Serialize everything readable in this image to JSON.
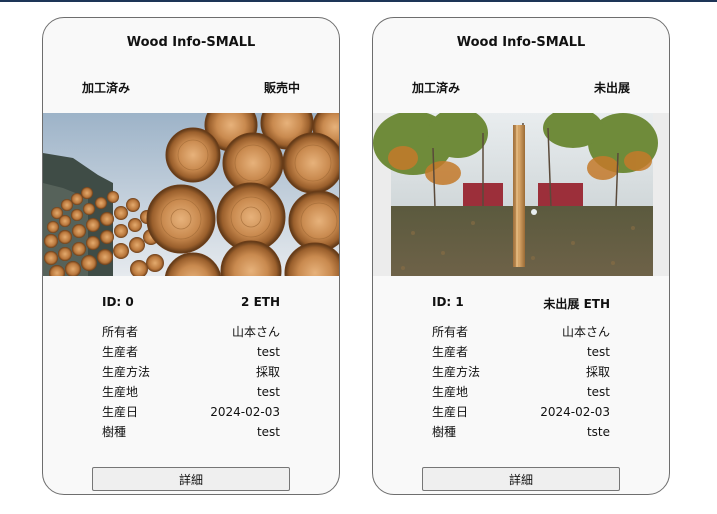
{
  "cards": [
    {
      "title": "Wood Info-SMALL",
      "processing_status": "加工済み",
      "sale_status": "販売中",
      "id_text": "ID: 0",
      "price_text": "2 ETH",
      "details": [
        {
          "label": "所有者",
          "value": "山本さん"
        },
        {
          "label": "生産者",
          "value": "test"
        },
        {
          "label": "生産方法",
          "value": "採取"
        },
        {
          "label": "生産地",
          "value": "test"
        },
        {
          "label": "生産日",
          "value": "2024-02-03"
        },
        {
          "label": "樹種",
          "value": "test"
        }
      ],
      "button_label": "詳細",
      "image": "stacked-logs-photo"
    },
    {
      "title": "Wood Info-SMALL",
      "processing_status": "加工済み",
      "sale_status": "未出展",
      "id_text": "ID: 1",
      "price_text": "未出展 ETH",
      "details": [
        {
          "label": "所有者",
          "value": "山本さん"
        },
        {
          "label": "生産者",
          "value": "test"
        },
        {
          "label": "生産方法",
          "value": "採取"
        },
        {
          "label": "生産地",
          "value": "test"
        },
        {
          "label": "生産日",
          "value": "2024-02-03"
        },
        {
          "label": "樹種",
          "value": "tste"
        }
      ],
      "button_label": "詳細",
      "image": "wooden-pole-in-park-photo"
    }
  ],
  "colors": {
    "top_bar": "#1d3557",
    "card_bg": "#f9f9f9",
    "card_border": "#6e6e6e",
    "button_bg": "#efefef"
  }
}
